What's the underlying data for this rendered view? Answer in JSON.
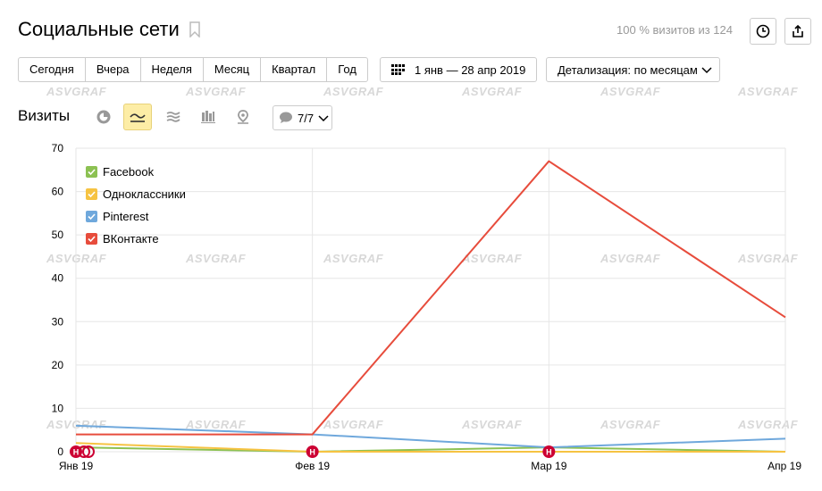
{
  "header": {
    "title": "Социальные сети",
    "visits_info": "100 % визитов из 124"
  },
  "periods": [
    "Сегодня",
    "Вчера",
    "Неделя",
    "Месяц",
    "Квартал",
    "Год"
  ],
  "date_range": "1 янв — 28 апр 2019",
  "detail": "Детализация: по месяцам",
  "metric": "Визиты",
  "series_filter": "7/7",
  "watermark": "ASVGRAF",
  "colors": {
    "facebook": "#8cc152",
    "odnoklassniki": "#f6c342",
    "pinterest": "#6fa8dc",
    "vkontakte": "#e74c3c",
    "annotation": "#cc0033",
    "active_viz": "#fdeda6"
  },
  "chart_data": {
    "type": "line",
    "x": [
      "Янв 19",
      "Фев 19",
      "Мар 19",
      "Апр 19"
    ],
    "ylim": [
      0,
      70
    ],
    "yticks": [
      0,
      10,
      20,
      30,
      40,
      50,
      60,
      70
    ],
    "grid": true,
    "legend_position": "top-left",
    "series": [
      {
        "name": "Facebook",
        "color": "#8cc152",
        "values": [
          1,
          0,
          1,
          0
        ]
      },
      {
        "name": "Одноклассники",
        "color": "#f6c342",
        "values": [
          2,
          0,
          0,
          0
        ]
      },
      {
        "name": "Pinterest",
        "color": "#6fa8dc",
        "values": [
          6,
          4,
          1,
          3
        ]
      },
      {
        "name": "ВКонтакте",
        "color": "#e74c3c",
        "values": [
          4,
          4,
          67,
          31
        ]
      }
    ],
    "annotations": [
      {
        "x": "Янв 19",
        "label": "Н"
      },
      {
        "x": "Фев 19",
        "label": "Н"
      },
      {
        "x": "Мар 19",
        "label": "Н"
      }
    ]
  }
}
